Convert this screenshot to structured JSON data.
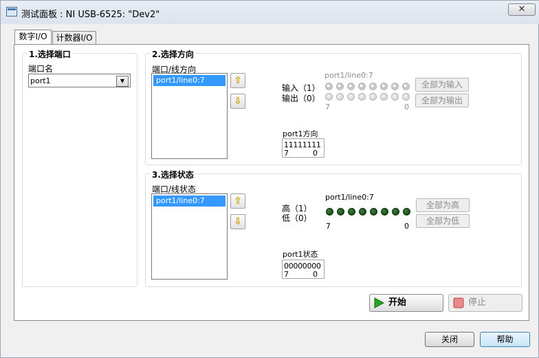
{
  "window": {
    "title": "测试面板 : NI USB-6525: \"Dev2\"",
    "close_label": "✕"
  },
  "tabs": [
    {
      "label": "数字I/O",
      "active": true
    },
    {
      "label": "计数器I/O",
      "active": false
    }
  ],
  "port_select": {
    "title": "1.选择端口",
    "field_label": "端口名",
    "value": "port1"
  },
  "direction": {
    "title": "2.选择方向",
    "list_label": "端口/线方向",
    "list_items": [
      "port1/line0:7"
    ],
    "line_label": "port1/line0:7",
    "input_label": "输入（1）",
    "output_label": "输出（0）",
    "led_states": [
      1,
      1,
      1,
      1,
      1,
      1,
      1,
      1
    ],
    "index_high": "7",
    "index_low": "0",
    "all_input_label": "全部为输入",
    "all_output_label": "全部为输出",
    "value_label": "port1方向",
    "value": "11111111",
    "value_high": "7",
    "value_low": "0"
  },
  "state": {
    "title": "3.选择状态",
    "list_label": "端口/线状态",
    "list_items": [
      "port1/line0:7"
    ],
    "line_label": "port1/line0:7",
    "high_label": "高（1）",
    "low_label": "低（0）",
    "led_states": [
      0,
      0,
      0,
      0,
      0,
      0,
      0,
      0
    ],
    "index_high": "7",
    "index_low": "0",
    "all_high_label": "全部为高",
    "all_low_label": "全部为低",
    "value_label": "port1状态",
    "value": "00000000",
    "value_high": "7",
    "value_low": "0"
  },
  "actions": {
    "start_label": "开始",
    "stop_label": "停止"
  },
  "footer": {
    "close_label": "关闭",
    "help_label": "帮助"
  },
  "colors": {
    "selection": "#3399ff",
    "start_icon": "#22a822",
    "stop_icon": "#d83030",
    "led_green": "#0d3d0d"
  },
  "icons": {
    "up": "up-arrow-icon",
    "down": "down-arrow-icon",
    "start": "play-icon",
    "stop": "stop-icon"
  }
}
